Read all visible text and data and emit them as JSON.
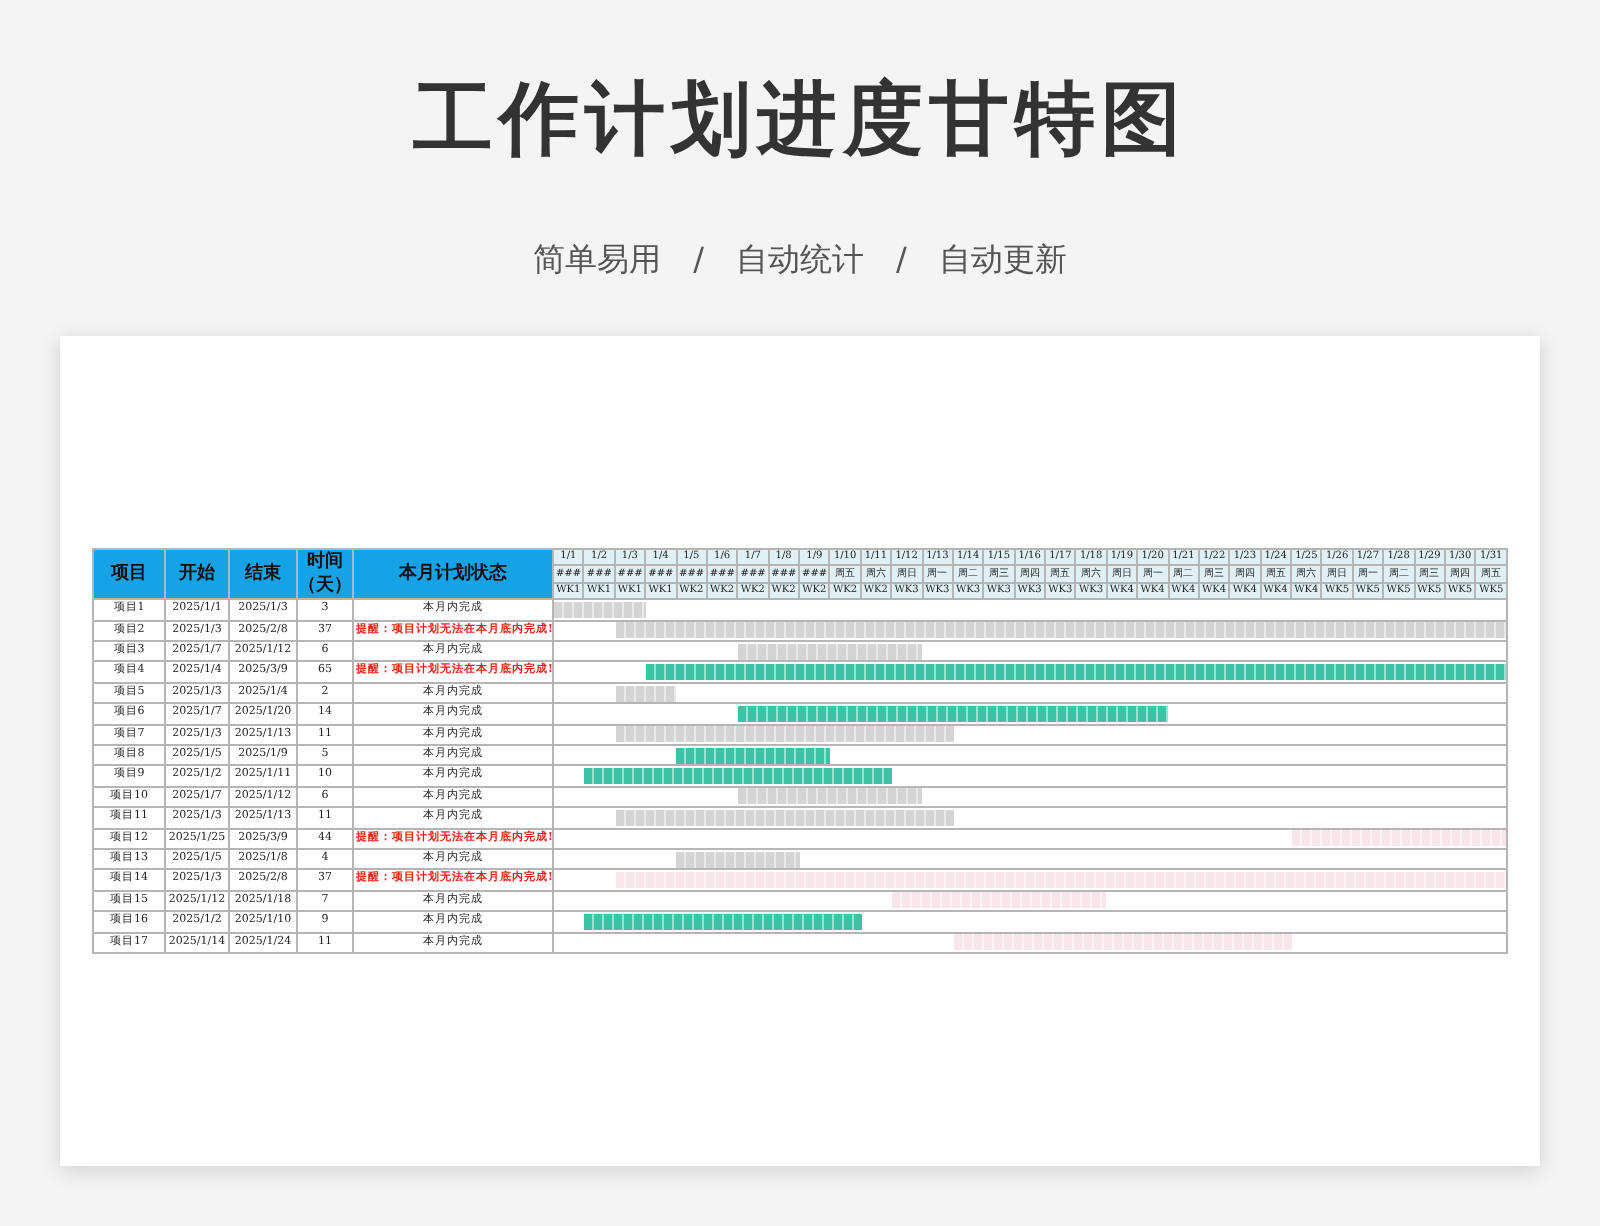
{
  "title": "工作计划进度甘特图",
  "subtitle": [
    "简单易用",
    "/",
    "自动统计",
    "/",
    "自动更新"
  ],
  "table": {
    "columns": [
      "项目",
      "开始",
      "结束",
      "时间（天）",
      "本月计划状态"
    ],
    "days": [
      {
        "date": "1/1",
        "weekday": "###",
        "week": "WK1"
      },
      {
        "date": "1/2",
        "weekday": "###",
        "week": "WK1"
      },
      {
        "date": "1/3",
        "weekday": "###",
        "week": "WK1"
      },
      {
        "date": "1/4",
        "weekday": "###",
        "week": "WK1"
      },
      {
        "date": "1/5",
        "weekday": "###",
        "week": "WK2"
      },
      {
        "date": "1/6",
        "weekday": "###",
        "week": "WK2"
      },
      {
        "date": "1/7",
        "weekday": "###",
        "week": "WK2"
      },
      {
        "date": "1/8",
        "weekday": "###",
        "week": "WK2"
      },
      {
        "date": "1/9",
        "weekday": "###",
        "week": "WK2"
      },
      {
        "date": "1/10",
        "weekday": "周五",
        "week": "WK2"
      },
      {
        "date": "1/11",
        "weekday": "周六",
        "week": "WK2"
      },
      {
        "date": "1/12",
        "weekday": "周日",
        "week": "WK3"
      },
      {
        "date": "1/13",
        "weekday": "周一",
        "week": "WK3"
      },
      {
        "date": "1/14",
        "weekday": "周二",
        "week": "WK3"
      },
      {
        "date": "1/15",
        "weekday": "周三",
        "week": "WK3"
      },
      {
        "date": "1/16",
        "weekday": "周四",
        "week": "WK3"
      },
      {
        "date": "1/17",
        "weekday": "周五",
        "week": "WK3"
      },
      {
        "date": "1/18",
        "weekday": "周六",
        "week": "WK3"
      },
      {
        "date": "1/19",
        "weekday": "周日",
        "week": "WK4"
      },
      {
        "date": "1/20",
        "weekday": "周一",
        "week": "WK4"
      },
      {
        "date": "1/21",
        "weekday": "周二",
        "week": "WK4"
      },
      {
        "date": "1/22",
        "weekday": "周三",
        "week": "WK4"
      },
      {
        "date": "1/23",
        "weekday": "周四",
        "week": "WK4"
      },
      {
        "date": "1/24",
        "weekday": "周五",
        "week": "WK4"
      },
      {
        "date": "1/25",
        "weekday": "周六",
        "week": "WK4"
      },
      {
        "date": "1/26",
        "weekday": "周日",
        "week": "WK5"
      },
      {
        "date": "1/27",
        "weekday": "周一",
        "week": "WK5"
      },
      {
        "date": "1/28",
        "weekday": "周二",
        "week": "WK5"
      },
      {
        "date": "1/29",
        "weekday": "周三",
        "week": "WK5"
      },
      {
        "date": "1/30",
        "weekday": "周四",
        "week": "WK5"
      },
      {
        "date": "1/31",
        "weekday": "周五",
        "week": "WK5"
      }
    ],
    "rows": [
      {
        "project": "项目1",
        "start": "2025/1/1",
        "end": "2025/1/3",
        "days": "3",
        "status": "本月内完成",
        "warning": false,
        "color": "#d4d4d4"
      },
      {
        "project": "项目2",
        "start": "2025/1/3",
        "end": "2025/2/8",
        "days": "37",
        "status": "提醒：项目计划无法在本月底内完成!",
        "warning": true,
        "color": "#d4d4d4"
      },
      {
        "project": "项目3",
        "start": "2025/1/7",
        "end": "2025/1/12",
        "days": "6",
        "status": "本月内完成",
        "warning": false,
        "color": "#d4d4d4"
      },
      {
        "project": "项目4",
        "start": "2025/1/4",
        "end": "2025/3/9",
        "days": "65",
        "status": "提醒：项目计划无法在本月底内完成!",
        "warning": true,
        "color": "#3cc3a5"
      },
      {
        "project": "项目5",
        "start": "2025/1/3",
        "end": "2025/1/4",
        "days": "2",
        "status": "本月内完成",
        "warning": false,
        "color": "#d4d4d4"
      },
      {
        "project": "项目6",
        "start": "2025/1/7",
        "end": "2025/1/20",
        "days": "14",
        "status": "本月内完成",
        "warning": false,
        "color": "#3cc3a5"
      },
      {
        "project": "项目7",
        "start": "2025/1/3",
        "end": "2025/1/13",
        "days": "11",
        "status": "本月内完成",
        "warning": false,
        "color": "#d4d4d4"
      },
      {
        "project": "项目8",
        "start": "2025/1/5",
        "end": "2025/1/9",
        "days": "5",
        "status": "本月内完成",
        "warning": false,
        "color": "#3cc3a5"
      },
      {
        "project": "项目9",
        "start": "2025/1/2",
        "end": "2025/1/11",
        "days": "10",
        "status": "本月内完成",
        "warning": false,
        "color": "#3cc3a5"
      },
      {
        "project": "项目10",
        "start": "2025/1/7",
        "end": "2025/1/12",
        "days": "6",
        "status": "本月内完成",
        "warning": false,
        "color": "#d4d4d4"
      },
      {
        "project": "项目11",
        "start": "2025/1/3",
        "end": "2025/1/13",
        "days": "11",
        "status": "本月内完成",
        "warning": false,
        "color": "#d4d4d4"
      },
      {
        "project": "项目12",
        "start": "2025/1/25",
        "end": "2025/3/9",
        "days": "44",
        "status": "提醒：项目计划无法在本月底内完成!",
        "warning": true,
        "color": "#f8e6ea"
      },
      {
        "project": "项目13",
        "start": "2025/1/5",
        "end": "2025/1/8",
        "days": "4",
        "status": "本月内完成",
        "warning": false,
        "color": "#d4d4d4"
      },
      {
        "project": "项目14",
        "start": "2025/1/3",
        "end": "2025/2/8",
        "days": "37",
        "status": "提醒：项目计划无法在本月底内完成!",
        "warning": true,
        "color": "#f8e6ea"
      },
      {
        "project": "项目15",
        "start": "2025/1/12",
        "end": "2025/1/18",
        "days": "7",
        "status": "本月内完成",
        "warning": false,
        "color": "#f8e6ea"
      },
      {
        "project": "项目16",
        "start": "2025/1/2",
        "end": "2025/1/10",
        "days": "9",
        "status": "本月内完成",
        "warning": false,
        "color": "#3cc3a5"
      },
      {
        "project": "项目17",
        "start": "2025/1/14",
        "end": "2025/1/24",
        "days": "11",
        "status": "本月内完成",
        "warning": false,
        "color": "#f8e6ea"
      }
    ]
  }
}
